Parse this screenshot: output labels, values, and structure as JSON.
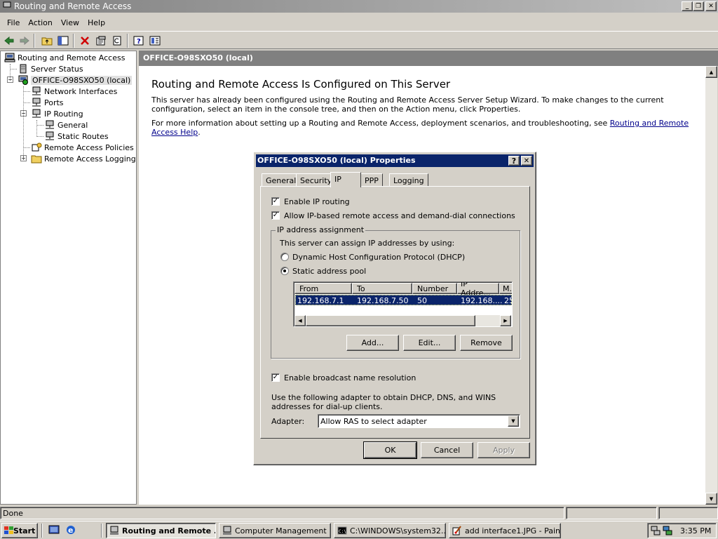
{
  "window": {
    "title": "Routing and Remote Access",
    "min_icon": "minimize-icon",
    "restore_icon": "restore-icon",
    "close_icon": "close-icon"
  },
  "menu": [
    "File",
    "Action",
    "View",
    "Help"
  ],
  "toolbar": [
    "back-icon",
    "forward-icon",
    "up-icon",
    "show-hide-tree-icon",
    "delete-icon",
    "properties-icon",
    "refresh-icon",
    "help-icon",
    "console-icon"
  ],
  "tree": {
    "root": "Routing and Remote Access",
    "server_status": "Server Status",
    "server": "OFFICE-O98SXO50 (local)",
    "network_interfaces": "Network Interfaces",
    "ports": "Ports",
    "ip_routing": "IP Routing",
    "general": "General",
    "static_routes": "Static Routes",
    "remote_access_policies": "Remote Access Policies",
    "remote_access_logging": "Remote Access Logging"
  },
  "right": {
    "header": "OFFICE-O98SXO50 (local)",
    "heading": "Routing and Remote Access Is Configured on This Server",
    "para1": "This server has already been configured using the Routing and Remote Access Server Setup Wizard. To make changes to the current configuration, select an item in the console tree, and then on the Action menu, click Properties.",
    "para2_prefix": "For more information about setting up a Routing and Remote Access, deployment scenarios, and troubleshooting, see ",
    "para2_link": "Routing and Remote Access Help",
    "para2_suffix": "."
  },
  "dialog": {
    "title": "OFFICE-O98SXO50 (local) Properties",
    "tabs": [
      "General",
      "Security",
      "IP",
      "PPP",
      "Logging"
    ],
    "active_tab": "IP",
    "enable_ip_routing": {
      "label": "Enable IP routing",
      "checked": true
    },
    "allow_ip_remote": {
      "label": "Allow IP-based remote access and demand-dial connections",
      "checked": true
    },
    "group_label": "IP address assignment",
    "assign_text": "This server can assign IP addresses by using:",
    "radio_dhcp": {
      "label": "Dynamic Host Configuration Protocol (DHCP)",
      "selected": false
    },
    "radio_static": {
      "label": "Static address pool",
      "selected": true
    },
    "list_columns": [
      "From",
      "To",
      "Number",
      "IP Addre...",
      "M..."
    ],
    "list_rows": [
      [
        "192.168.7.1",
        "192.168.7.50",
        "50",
        "192.168....",
        "25"
      ]
    ],
    "add_label": "Add...",
    "edit_label": "Edit...",
    "remove_label": "Remove",
    "broadcast": {
      "label": "Enable broadcast name resolution",
      "checked": true
    },
    "adapter_text": "Use the following adapter to obtain DHCP, DNS, and WINS addresses for dial-up clients.",
    "adapter_label": "Adapter:",
    "adapter_value": "Allow RAS to select adapter",
    "ok_label": "OK",
    "cancel_label": "Cancel",
    "apply_label": "Apply"
  },
  "status": {
    "text": "Done"
  },
  "taskbar": {
    "start": "Start",
    "tasks": [
      "Routing and Remote ...",
      "Computer Management",
      "C:\\WINDOWS\\system32...",
      "add interface1.JPG - Paint"
    ],
    "clock": "3:35 PM"
  }
}
